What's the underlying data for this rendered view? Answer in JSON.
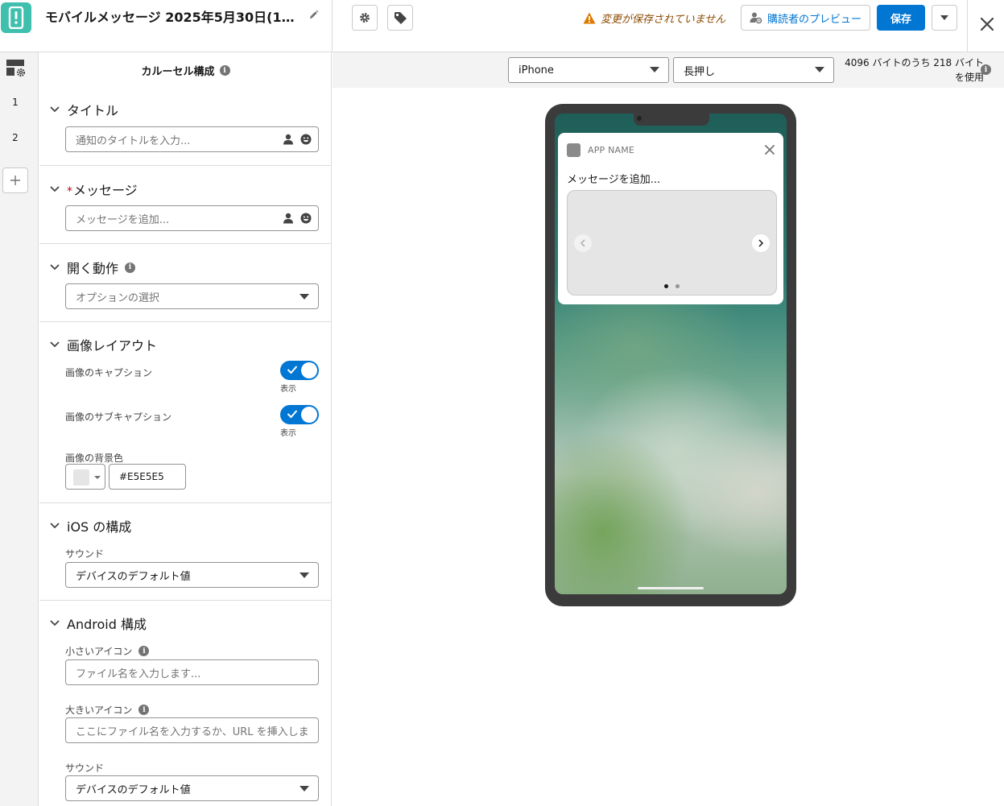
{
  "header": {
    "title": "モバイルメッセージ 2025年5月30日(14:...",
    "unsaved_text": "変更が保存されていません",
    "preview_label": "購読者のプレビュー",
    "save_label": "保存"
  },
  "rail": {
    "items": [
      "1",
      "2"
    ]
  },
  "panel": {
    "title": "カルーセル構成",
    "title_section": {
      "label": "タイトル",
      "placeholder": "通知のタイトルを入力..."
    },
    "message_section": {
      "required_mark": "*",
      "label": "メッセージ",
      "placeholder": "メッセージを追加..."
    },
    "open_action": {
      "label": "開く動作",
      "placeholder": "オプションの選択"
    },
    "image_layout": {
      "label": "画像レイアウト",
      "caption_label": "画像のキャプション",
      "caption_toggle_caption": "表示",
      "caption_on": true,
      "subcaption_label": "画像のサブキャプション",
      "subcaption_toggle_caption": "表示",
      "subcaption_on": true,
      "bg_label": "画像の背景色",
      "bg_value": "#E5E5E5"
    },
    "ios": {
      "label": "iOS の構成",
      "sound_label": "サウンド",
      "sound_value": "デバイスのデフォルト値"
    },
    "android": {
      "label": "Android 構成",
      "small_icon_label": "小さいアイコン",
      "small_icon_placeholder": "ファイル名を入力します...",
      "large_icon_label": "大きいアイコン",
      "large_icon_placeholder": "ここにファイル名を入力するか、URL を挿入しま",
      "sound_label": "サウンド",
      "sound_value": "デバイスのデフォルト値"
    }
  },
  "preview": {
    "device": "iPhone",
    "mode": "長押し",
    "bytes_text": "4096 バイトのうち 218 バイトを使用",
    "notification": {
      "app_name": "APP NAME",
      "message": "メッセージを追加...",
      "carousel_pages": 2,
      "carousel_active": 1
    }
  },
  "colors": {
    "brand": "#0176d3",
    "app_icon": "#3fbfad",
    "warning": "#dd7a01",
    "carousel_bg": "#E5E5E5"
  }
}
